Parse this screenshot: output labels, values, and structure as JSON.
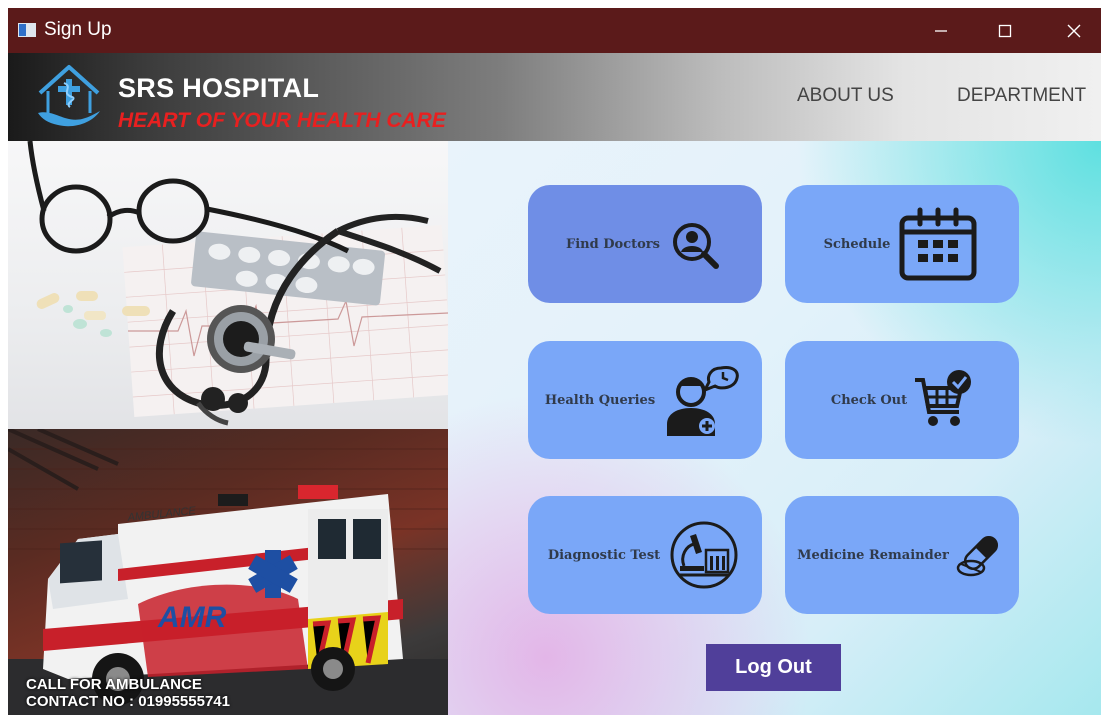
{
  "window": {
    "title": "Sign Up"
  },
  "header": {
    "brand_name": "SRS HOSPITAL",
    "tagline": "HEART OF YOUR HEALTH CARE",
    "nav": [
      "ABOUT US",
      "DEPARTMENT"
    ]
  },
  "ambulance_panel": {
    "call_text": "CALL FOR AMBULANCE",
    "contact_text": "CONTACT NO : 01995555741",
    "vehicle_label": "AMBULANCE",
    "vehicle_brand": "AMR"
  },
  "menu": {
    "tiles": [
      {
        "label": "Find Doctors",
        "icon": "doctor-search-icon"
      },
      {
        "label": "Schedule",
        "icon": "calendar-icon"
      },
      {
        "label": "Health Queries",
        "icon": "doctor-chat-icon"
      },
      {
        "label": "Check Out",
        "icon": "cart-check-icon"
      },
      {
        "label": "Diagnostic Test",
        "icon": "microscope-icon"
      },
      {
        "label": "Medicine Remainder",
        "icon": "pill-icon"
      }
    ],
    "logout_label": "Log Out"
  },
  "colors": {
    "titlebar": "#5b1a1a",
    "tile": "#7aa7f8",
    "tile_active": "#6f8ee6",
    "logout": "#503f9a",
    "tagline": "#e82020"
  }
}
